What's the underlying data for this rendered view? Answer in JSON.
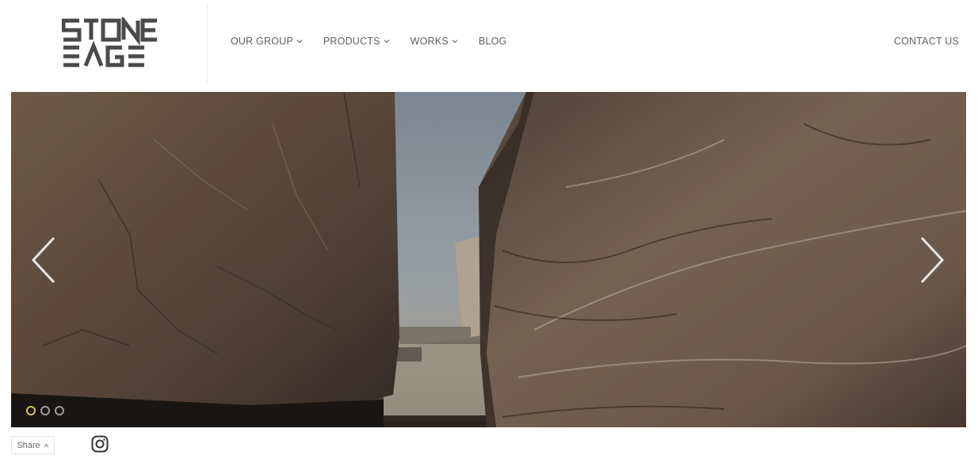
{
  "header": {
    "logo": {
      "line1": "STONE",
      "line2": "EAGE",
      "color": "#4a4a4a"
    },
    "nav": [
      {
        "label": "OUR GROUP",
        "has_dropdown": true
      },
      {
        "label": "PRODUCTS",
        "has_dropdown": true
      },
      {
        "label": "WORKS",
        "has_dropdown": true
      },
      {
        "label": "BLOG",
        "has_dropdown": false
      }
    ],
    "contact_label": "CONTACT US"
  },
  "hero": {
    "slides_total": 3,
    "active_slide": 1,
    "prev_icon": "chevron-left-icon",
    "next_icon": "chevron-right-icon",
    "active_dot_color": "#d2c463"
  },
  "footer": {
    "share_label": "Share",
    "share_icon": "caret-up-icon",
    "social_icon": "instagram-icon"
  }
}
